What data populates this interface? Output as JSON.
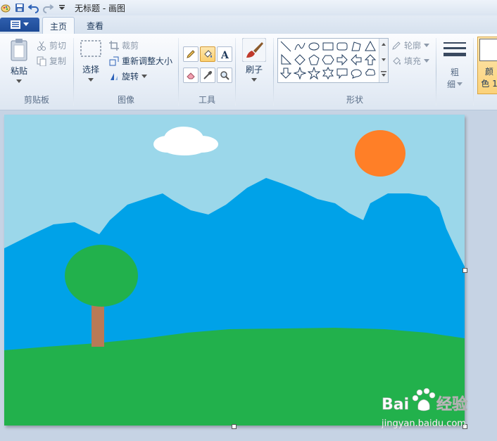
{
  "titlebar": {
    "title": "无标题 - 画图",
    "icons": [
      "paint-app-icon",
      "save-icon",
      "undo-icon",
      "redo-icon",
      "customize-dropdown-icon"
    ]
  },
  "tabs": [
    {
      "label": "主页",
      "active": true
    },
    {
      "label": "查看",
      "active": false
    }
  ],
  "clipboard": {
    "paste_label": "粘贴",
    "cut_label": "剪切",
    "copy_label": "复制",
    "group_label": "剪贴板"
  },
  "image": {
    "select_label": "选择",
    "crop_label": "裁剪",
    "resize_label": "重新调整大小",
    "rotate_label": "旋转",
    "group_label": "图像"
  },
  "tools": {
    "group_label": "工具",
    "items": [
      "pencil-icon",
      "fill-icon",
      "text-icon",
      "eraser-icon",
      "color-picker-icon",
      "magnifier-icon"
    ],
    "active": "fill-icon"
  },
  "brushes": {
    "label": "刷子"
  },
  "shapes": {
    "group_label": "形状",
    "outline_label": "轮廓",
    "fill_label": "填充"
  },
  "size": {
    "label_line1": "粗",
    "label_line2": "细"
  },
  "colors": {
    "label_line1": "颜",
    "label_line2": "色 1",
    "sky": "#9bd7ea",
    "mountain": "#00a2e8",
    "grass": "#22b14c",
    "sun": "#ff7f27",
    "trunk": "#b97a57",
    "cloud": "#ffffff"
  },
  "watermark": {
    "brand": "Bai",
    "brand_cn": "经验",
    "url": "jingyan.baidu.com"
  }
}
